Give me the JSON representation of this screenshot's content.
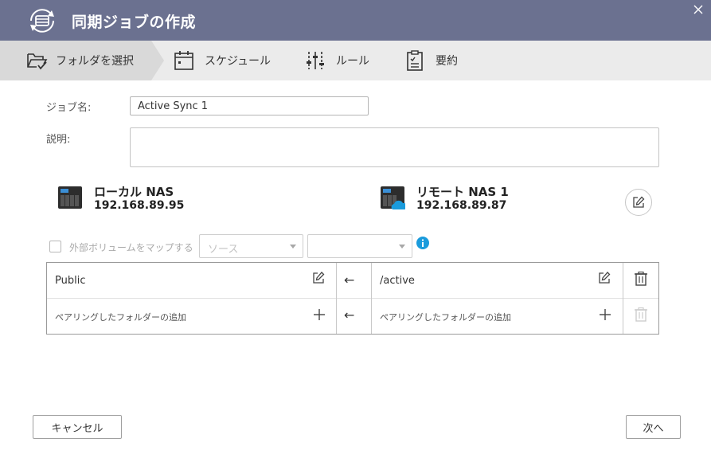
{
  "dialog": {
    "title": "同期ジョブの作成",
    "close_glyph": "×"
  },
  "steps": [
    {
      "label": "フォルダを選択",
      "icon": "folder-select-icon",
      "active": true
    },
    {
      "label": "スケジュール",
      "icon": "calendar-icon",
      "active": false
    },
    {
      "label": "ルール",
      "icon": "sliders-icon",
      "active": false
    },
    {
      "label": "要約",
      "icon": "clipboard-icon",
      "active": false
    }
  ],
  "form": {
    "job_name_label": "ジョブ名:",
    "job_name_value": "Active Sync 1",
    "description_label": "説明:",
    "description_value": ""
  },
  "local_nas": {
    "name": "ローカル NAS",
    "ip": "192.168.89.95"
  },
  "remote_nas": {
    "name": "リモート NAS 1",
    "ip": "192.168.89.87"
  },
  "external_volume": {
    "label": "外部ボリュームをマップする",
    "checked": false,
    "source_placeholder": "ソース",
    "target_placeholder": ""
  },
  "pairs": {
    "rows": [
      {
        "local": "Public",
        "arrow": "←",
        "remote": "/active"
      },
      {
        "local": "ペアリングしたフォルダーの追加",
        "arrow": "←",
        "remote": "ペアリングしたフォルダーの追加"
      }
    ]
  },
  "footer": {
    "cancel_label": "キャンセル",
    "next_label": "次へ"
  },
  "colors": {
    "titlebar": "#6b7190",
    "stepbar": "#ebebeb",
    "active_step": "#d9d9d9",
    "info": "#1a9bdc",
    "cloud": "#1a9bdc"
  }
}
